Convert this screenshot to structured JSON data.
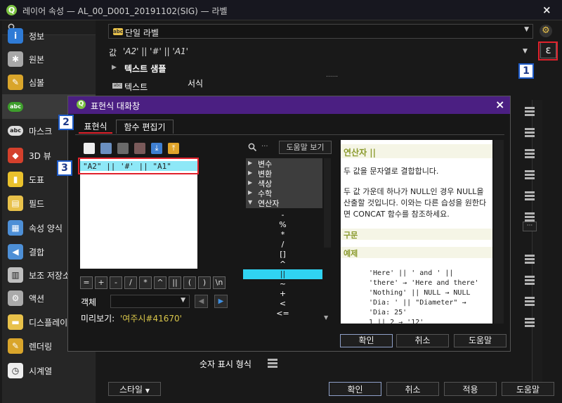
{
  "window": {
    "title": "레이어 속성 — AL_00_D001_20191102(SIG) — 라벨",
    "close": "×"
  },
  "sidebar": {
    "search_icon": "magnifier-icon",
    "items": [
      {
        "label": "정보",
        "icon": "info-icon",
        "color": "#2f7bd6",
        "glyph": "i"
      },
      {
        "label": "원본",
        "icon": "wrench-icon",
        "color": "#a8a8a8",
        "glyph": "✱"
      },
      {
        "label": "심볼",
        "icon": "brush-icon",
        "color": "#d9a52b",
        "glyph": "✎"
      },
      {
        "label": "",
        "icon": "abc-label-icon",
        "color": "#3e9e2c",
        "glyph": "abc"
      },
      {
        "label": "마스크",
        "icon": "abc-mask-icon",
        "color": "#ddd",
        "glyph": "abc"
      },
      {
        "label": "3D 뷰",
        "icon": "cube-icon",
        "color": "#d4402c",
        "glyph": "◆"
      },
      {
        "label": "도표",
        "icon": "diagram-icon",
        "color": "#e9c12c",
        "glyph": "▮"
      },
      {
        "label": "필드",
        "icon": "fields-icon",
        "color": "#e8c14a",
        "glyph": "▤"
      },
      {
        "label": "속성 양식",
        "icon": "form-icon",
        "color": "#4d8fd6",
        "glyph": "▦"
      },
      {
        "label": "결합",
        "icon": "join-icon",
        "color": "#4d8fd6",
        "glyph": "◀"
      },
      {
        "label": "보조 저장소",
        "icon": "storage-icon",
        "color": "#bfbfbf",
        "glyph": "▥"
      },
      {
        "label": "액션",
        "icon": "gear-action-icon",
        "color": "#aaaaaa",
        "glyph": "⚙"
      },
      {
        "label": "디스플레이",
        "icon": "speech-bubble-icon",
        "color": "#e8c14a",
        "glyph": "▬"
      },
      {
        "label": "렌더링",
        "icon": "brush-render-icon",
        "color": "#d9a52b",
        "glyph": "✎"
      },
      {
        "label": "시계열",
        "icon": "clock-icon",
        "color": "#eeeeee",
        "glyph": "◷"
      }
    ]
  },
  "main": {
    "label_mode": "단일 라벨",
    "value_label": "값",
    "value_expr": "'A2' || '#' || 'A1'",
    "text_sample": "텍스트 샘플",
    "sample_dots": "......",
    "format_label": "서식",
    "text_row": "텍스트",
    "number_format": "숫자 표시 형식",
    "style_btn": "스타일",
    "ok": "확인",
    "cancel": "취소",
    "apply": "적용",
    "help": "도움말",
    "more_btn": "···"
  },
  "annotations": {
    "one": "1",
    "two": "2",
    "three": "3"
  },
  "dialog": {
    "title": "표현식 대화창",
    "close": "×",
    "tabs": [
      "표현식",
      "함수 편집기"
    ],
    "expression": "\"A2\" || '#' || \"A1\"",
    "object_label": "객체",
    "preview_label": "미리보기:",
    "preview_value": "'여주시#41670'",
    "search_dots": "···",
    "help_btn": "도움말 보기",
    "op_buttons": [
      "=",
      "+",
      "-",
      "/",
      "*",
      "^",
      "||",
      "(",
      ")",
      "\\n"
    ],
    "tree": [
      {
        "label": "변수",
        "expanded": false
      },
      {
        "label": "변환",
        "expanded": false
      },
      {
        "label": "색상",
        "expanded": false
      },
      {
        "label": "수학",
        "expanded": false
      },
      {
        "label": "연산자",
        "expanded": true
      }
    ],
    "operators": [
      "-",
      "%",
      "*",
      "/",
      "[]",
      "^",
      "||",
      "~",
      "+",
      "<",
      "<="
    ],
    "help_panel": {
      "title": "연산자 ||",
      "desc1": "두 값을 문자열로 결합합니다.",
      "desc2": "두 값 가운데 하나가 NULL인 경우 NULL을 산출할 것입니다. 이와는 다른 습성을 원한다면 CONCAT 함수를 참조하세요.",
      "syntax_header": "구문",
      "examples_header": "예제",
      "examples": [
        "'Here' || ' and ' ||",
        "'there' → 'Here and there'",
        "'Nothing' || NULL → NULL",
        "'Dia: ' || \"Diameter\" →",
        "'Dia: 25'",
        "1 || 2 → '12'"
      ]
    },
    "ok": "확인",
    "cancel": "취소",
    "help": "도움말"
  },
  "colors": {
    "accent": "#4b1f82",
    "annotation_red": "#e0222c",
    "annotation_blue": "#1e5bc8",
    "selected_op": "#30d3f2"
  }
}
